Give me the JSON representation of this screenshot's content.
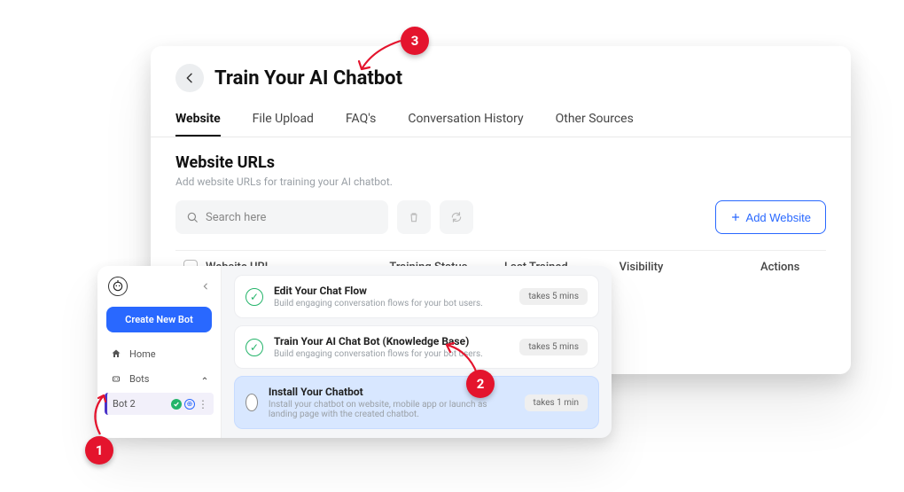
{
  "header": {
    "title": "Train Your AI Chatbot"
  },
  "tabs": [
    "Website",
    "File Upload",
    "FAQ's",
    "Conversation History",
    "Other Sources"
  ],
  "section": {
    "title": "Website URLs",
    "subtitle": "Add website URLs for training your AI chatbot."
  },
  "search": {
    "placeholder": "Search here"
  },
  "add_button": "Add Website",
  "table": {
    "columns": [
      "Website URL",
      "Training Status",
      "Last Trained",
      "Visibility",
      "Actions"
    ]
  },
  "sidebar": {
    "create": "Create New Bot",
    "home": "Home",
    "bots": "Bots",
    "bot_item": "Bot 2"
  },
  "steps": [
    {
      "title": "Edit Your Chat Flow",
      "desc": "Build engaging conversation flows for your bot users.",
      "tag": "takes 5 mins",
      "active": false
    },
    {
      "title": "Train Your AI Chat Bot (Knowledge Base)",
      "desc": "Build engaging conversation flows for your bot users.",
      "tag": "takes 5 mins",
      "active": false
    },
    {
      "title": "Install Your Chatbot",
      "desc": "Install your chatbot on website, mobile app or launch as landing page with the created chatbot.",
      "tag": "takes 1 min",
      "active": true
    }
  ],
  "annotations": {
    "a1": "1",
    "a2": "2",
    "a3": "3"
  }
}
